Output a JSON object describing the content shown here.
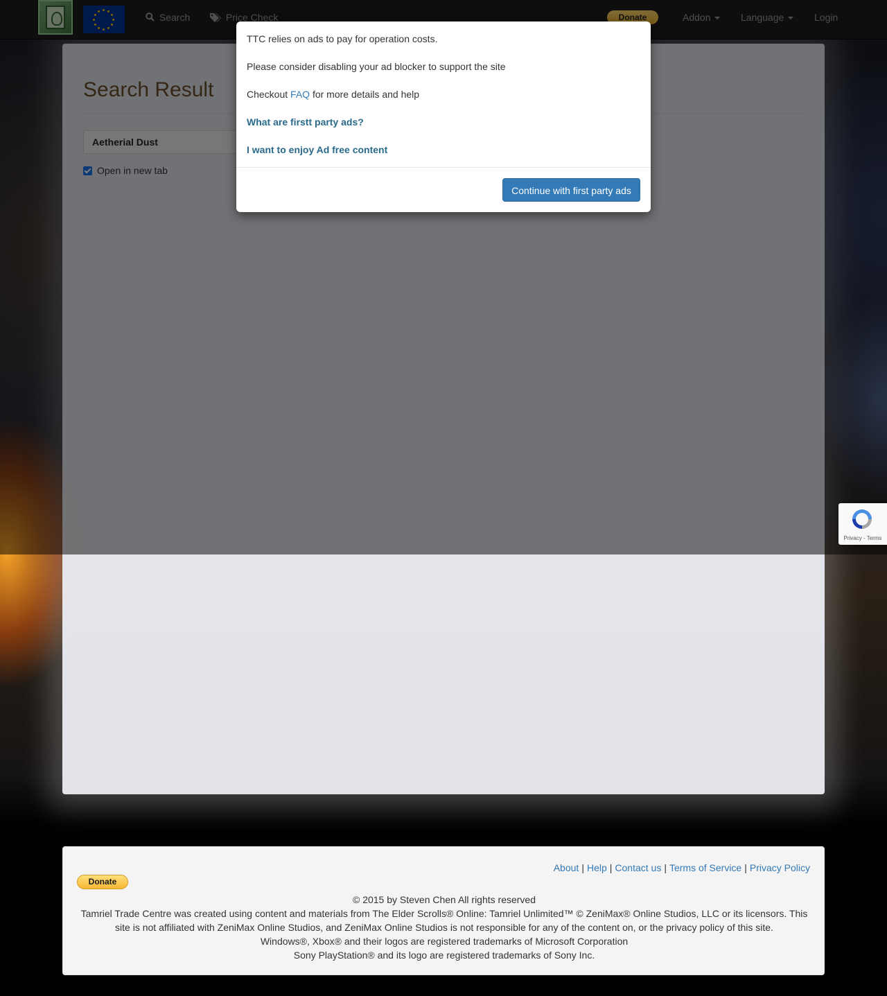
{
  "navbar": {
    "logo_name": "ttc-logo",
    "flag_name": "eu-flag",
    "search_label": "Search",
    "price_check_label": "Price Check",
    "donate_label": "Donate",
    "addon_label": "Addon",
    "language_label": "Language",
    "login_label": "Login"
  },
  "main": {
    "title": "Search Result",
    "search_value": "Aetherial Dust",
    "open_new_tab_label": "Open in new tab",
    "open_new_tab_checked": true
  },
  "modal": {
    "line1": "TTC relies on ads to pay for operation costs.",
    "line2": "Please consider disabling your ad blocker to support the site",
    "line3_prefix": "Checkout",
    "line3_link": "FAQ",
    "line3_suffix": "for more details and help",
    "link_first_party": "What are firstt party ads?",
    "link_ad_free": "I want to enjoy Ad free content",
    "continue_button": "Continue with first party ads"
  },
  "recaptcha": {
    "privacy": "Privacy",
    "terms": "Terms"
  },
  "footer": {
    "links": [
      "About",
      "Help",
      "Contact us",
      "Terms of Service",
      "Privacy Policy"
    ],
    "donate_label": "Donate",
    "copyright": "© 2015 by Steven Chen All rights reserved",
    "disclaimer": "Tamriel Trade Centre was created using content and materials from The Elder Scrolls® Online: Tamriel Unlimited™ © ZeniMax® Online Studios, LLC or its licensors. This site is not affiliated with ZeniMax Online Studios, and ZeniMax Online Studios is not responsible for any of the content on, or the privacy policy of this site.",
    "microsoft": "Windows®, Xbox® and their logos are registered trademarks of Microsoft Corporation",
    "sony": "Sony PlayStation® and its logo are registered trademarks of Sony Inc."
  },
  "colors": {
    "accent": "#337ab7",
    "title_brown": "#6b4e2b",
    "navbar_bg": "#1c1c1c",
    "donate_gold": "#f5b731"
  }
}
